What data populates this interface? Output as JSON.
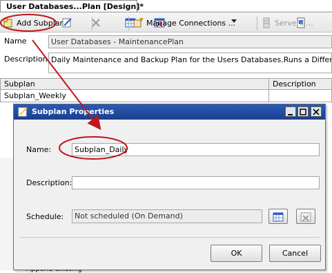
{
  "tab": {
    "title": "User Databases...Plan [Design]*"
  },
  "toolbar": {
    "add_subplan": "Add Subplan",
    "manage_connections": "Manage Connections ...",
    "servers": "Servers ..."
  },
  "plan": {
    "name_label": "Name",
    "name_value": "User Databases - MaintenancePlan",
    "description_label": "Description",
    "description_value": "Daily Maintenance and Backup Plan for the Users Databases.Runs a Differential Data"
  },
  "grid": {
    "columns": [
      "Subplan",
      "Description"
    ],
    "rows": [
      {
        "subplan": "Subplan_Weekly",
        "description": ""
      }
    ]
  },
  "background_partial": "Append existing",
  "dialog": {
    "title": "Subplan Properties",
    "name_label": "Name:",
    "name_value": "Subplan_Daily",
    "description_label": "Description:",
    "description_value": "",
    "schedule_label": "Schedule:",
    "schedule_value": "Not scheduled (On Demand)",
    "ok": "OK",
    "cancel": "Cancel"
  },
  "colors": {
    "annotation": "#c0141c",
    "titlebar": "#1f4aa3"
  }
}
